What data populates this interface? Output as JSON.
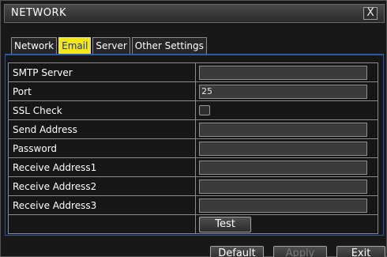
{
  "window": {
    "title": "NETWORK",
    "close_label": "X"
  },
  "tabs": [
    {
      "label": "Network",
      "active": false
    },
    {
      "label": "Email",
      "active": true
    },
    {
      "label": "Server",
      "active": false
    },
    {
      "label": "Other Settings",
      "active": false
    }
  ],
  "form": {
    "rows": [
      {
        "label": "SMTP Server",
        "type": "text",
        "value": ""
      },
      {
        "label": "Port",
        "type": "text",
        "value": "25"
      },
      {
        "label": "SSL Check",
        "type": "checkbox",
        "checked": false
      },
      {
        "label": "Send Address",
        "type": "text",
        "value": ""
      },
      {
        "label": "Password",
        "type": "password",
        "value": ""
      },
      {
        "label": "Receive Address1",
        "type": "text",
        "value": ""
      },
      {
        "label": "Receive Address2",
        "type": "text",
        "value": ""
      },
      {
        "label": "Receive Address3",
        "type": "text",
        "value": ""
      }
    ],
    "test_label": "Test"
  },
  "footer": {
    "default_label": "Default",
    "apply_label": "Apply",
    "exit_label": "Exit"
  },
  "colors": {
    "active_tab_bg": "#f4e514",
    "active_tab_text": "#1533a8",
    "panel_border": "#2d5aa6"
  },
  "icons": {
    "close": "close-icon"
  }
}
